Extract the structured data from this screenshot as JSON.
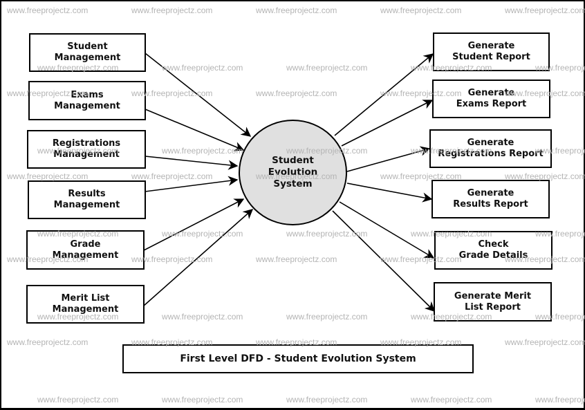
{
  "diagram": {
    "title": "First Level DFD - Student Evolution System",
    "process": "Student\nEvolution\nSystem",
    "sources": [
      "Student\nManagement",
      "Exams\nManagement",
      "Registrations\nManagement",
      "Results\nManagement",
      "Grade\nManagement",
      "Merit List\nManagement"
    ],
    "outputs": [
      "Generate\nStudent Report",
      "Generate\nExams Report",
      "Generate\nRegistrations Report",
      "Generate\nResults Report",
      "Check\nGrade Details",
      "Generate Merit\nList Report"
    ],
    "colors": {
      "process_fill": "#e0e0e0",
      "stroke": "#000000",
      "watermark": "#b4b4b4"
    }
  },
  "watermark": "www.freeprojectz.com"
}
